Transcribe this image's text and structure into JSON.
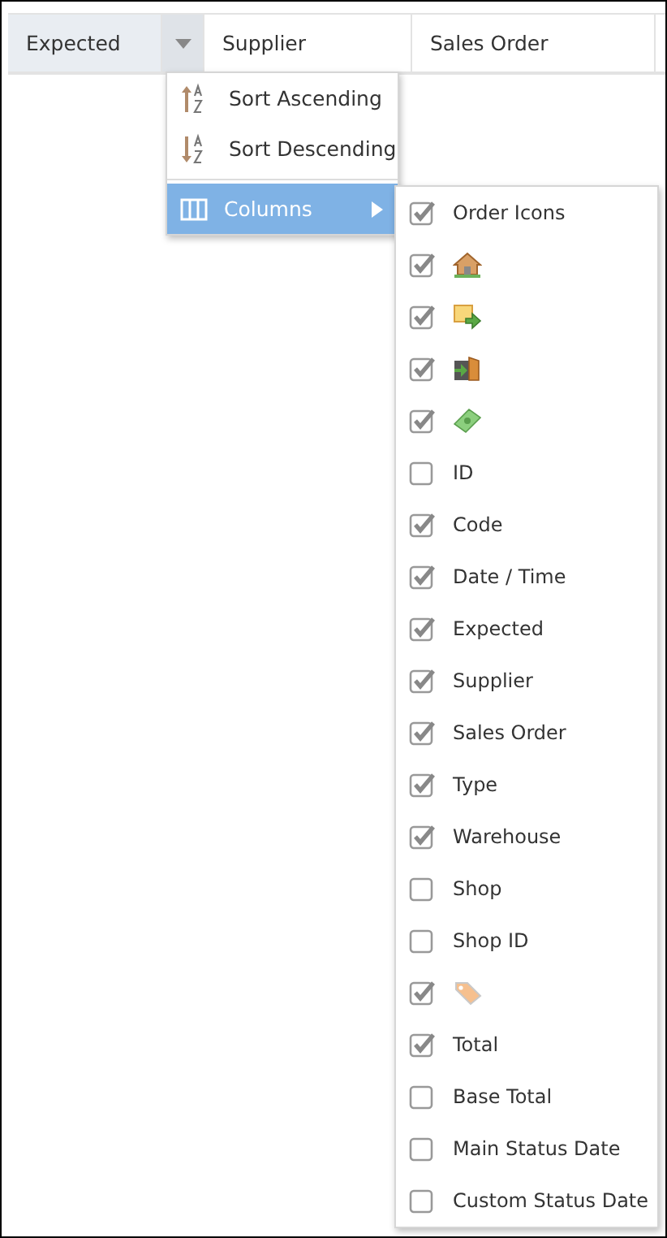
{
  "grid": {
    "columns": [
      {
        "label": "Expected",
        "selected": true
      },
      {
        "label": "Supplier",
        "selected": false
      },
      {
        "label": "Sales Order",
        "selected": false
      }
    ]
  },
  "column_menu": {
    "items": [
      {
        "label": "Sort Ascending",
        "kind": "sort-asc",
        "selected": false
      },
      {
        "label": "Sort Descending",
        "kind": "sort-desc",
        "selected": false
      },
      {
        "label": "Columns",
        "kind": "submenu",
        "selected": true
      }
    ]
  },
  "columns_submenu": {
    "items": [
      {
        "kind": "text",
        "label": "Order Icons",
        "checked": true
      },
      {
        "kind": "icon",
        "checked": true
      },
      {
        "kind": "icon",
        "checked": true
      },
      {
        "kind": "icon",
        "checked": true
      },
      {
        "kind": "icon",
        "checked": true
      },
      {
        "kind": "text",
        "label": "ID",
        "checked": false
      },
      {
        "kind": "text",
        "label": "Code",
        "checked": true
      },
      {
        "kind": "text",
        "label": "Date / Time",
        "checked": true
      },
      {
        "kind": "text",
        "label": "Expected",
        "checked": true
      },
      {
        "kind": "text",
        "label": "Supplier",
        "checked": true
      },
      {
        "kind": "text",
        "label": "Sales Order",
        "checked": true
      },
      {
        "kind": "text",
        "label": "Type",
        "checked": true
      },
      {
        "kind": "text",
        "label": "Warehouse",
        "checked": true
      },
      {
        "kind": "text",
        "label": "Shop",
        "checked": false
      },
      {
        "kind": "text",
        "label": "Shop ID",
        "checked": false
      },
      {
        "kind": "icon",
        "checked": true
      },
      {
        "kind": "text",
        "label": "Total",
        "checked": true
      },
      {
        "kind": "text",
        "label": "Base Total",
        "checked": false
      },
      {
        "kind": "text",
        "label": "Main Status Date",
        "checked": false
      },
      {
        "kind": "text",
        "label": "Custom Status Date",
        "checked": false
      }
    ]
  }
}
